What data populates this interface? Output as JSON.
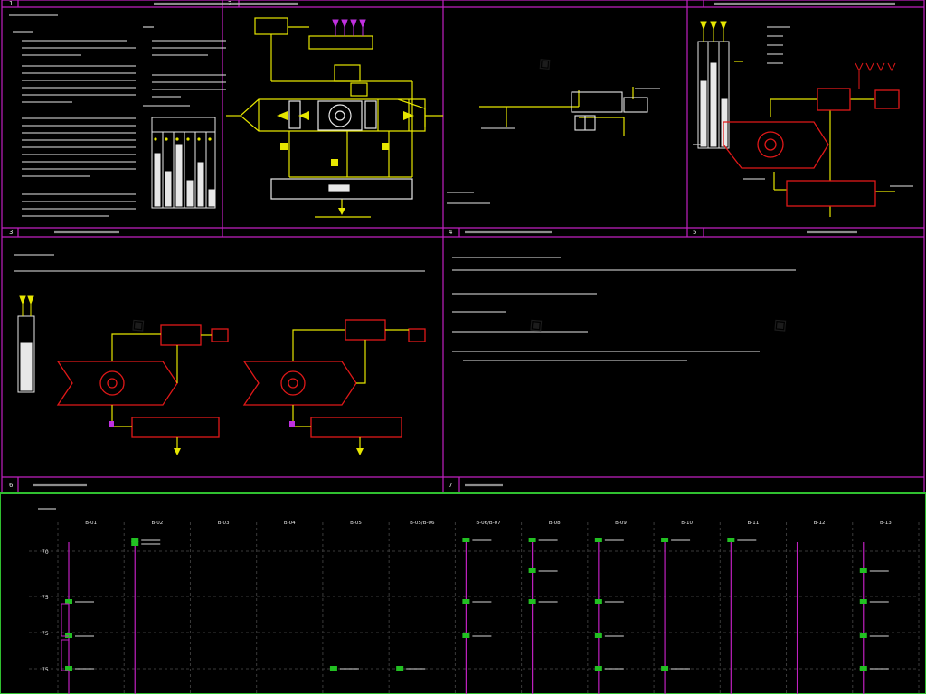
{
  "colors": {
    "background": "#000000",
    "frame": "#c020c0",
    "schematic": "#e6e600",
    "equipment_outline": "#e01818",
    "annotation": "#e8e8e8",
    "grid": "#3a3a3a",
    "tag_box": "#22c022",
    "border": "#30c030"
  },
  "panels": {
    "cell_1": {
      "number": "1"
    },
    "cell_2": {
      "number": "2"
    },
    "cell_3": {
      "number": "3"
    },
    "cell_4": {
      "number": "4"
    },
    "cell_5": {
      "number": "5"
    },
    "cell_6": {
      "number": "6"
    },
    "cell_7": {
      "number": "7"
    }
  },
  "schedule": {
    "rows": [
      "70",
      "75",
      "75",
      "75"
    ],
    "columns": [
      {
        "label": "B-01",
        "vertical": "magenta"
      },
      {
        "label": "B-02",
        "vertical": "magenta"
      },
      {
        "label": "B-03",
        "vertical": "none"
      },
      {
        "label": "B-04",
        "vertical": "none"
      },
      {
        "label": "B-05",
        "vertical": "none"
      },
      {
        "label": "B-05/B-06",
        "vertical": "none"
      },
      {
        "label": "B-06/B-07",
        "vertical": "magenta"
      },
      {
        "label": "B-08",
        "vertical": "magenta"
      },
      {
        "label": "B-09",
        "vertical": "magenta"
      },
      {
        "label": "B-10",
        "vertical": "magenta"
      },
      {
        "label": "B-11",
        "vertical": "magenta"
      },
      {
        "label": "B-12",
        "vertical": "magenta"
      },
      {
        "label": "B-13",
        "vertical": "magenta"
      }
    ]
  }
}
